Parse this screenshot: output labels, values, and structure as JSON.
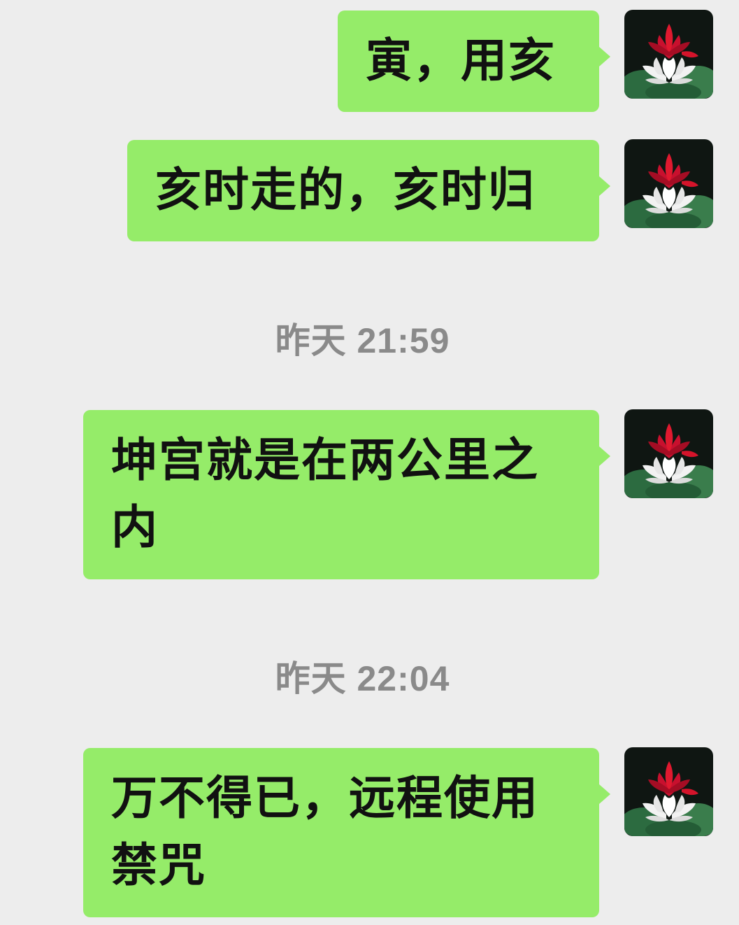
{
  "messages": [
    {
      "text": "寅，用亥"
    },
    {
      "text": "亥时走的，亥时归"
    },
    {
      "text": "坤宫就是在两公里之内"
    },
    {
      "text": "万不得已，远程使用禁咒"
    }
  ],
  "timestamps": [
    {
      "label": "昨天 21:59"
    },
    {
      "label": "昨天 22:04"
    }
  ],
  "avatar_icon": "lotus-flower-icon",
  "colors": {
    "background": "#ededed",
    "bubble": "#95ec69",
    "text": "#111111",
    "timestamp": "#8a8a8a"
  }
}
